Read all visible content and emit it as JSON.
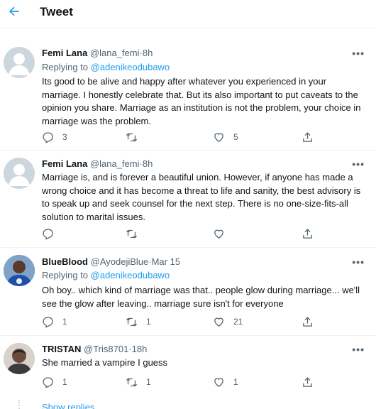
{
  "header": {
    "title": "Tweet"
  },
  "tweets": [
    {
      "name": "Femi Lana",
      "handle": "@lana_femi",
      "dot": "·",
      "time": "8h",
      "replying_prefix": "Replying to",
      "replying_to": "@adenikeodubawo",
      "text": "Its good to be alive and happy after whatever you experienced in your marriage. I honestly celebrate that. But its also important to put caveats to the opinion you share. Marriage as an institution is not the problem, your choice in marriage was the problem.",
      "counts": {
        "reply": "3",
        "retweet": "",
        "like": "5"
      }
    },
    {
      "name": "Femi Lana",
      "handle": "@lana_femi",
      "dot": "·",
      "time": "8h",
      "text": "Marriage is, and is forever a beautiful union. However, if anyone has made a wrong choice and it has become a threat to life and sanity, the best advisory is to speak up and seek counsel for the next step. There is no one-size-fits-all solution to marital issues.",
      "counts": {
        "reply": "",
        "retweet": "",
        "like": ""
      }
    },
    {
      "name": "BlueBlood",
      "handle": "@AyodejiBlue",
      "dot": "·",
      "time": "Mar 15",
      "replying_prefix": "Replying to",
      "replying_to": "@adenikeodubawo",
      "text": "Oh boy.. which kind of marriage was that.. people glow during marriage... we'll see the glow after leaving.. marriage sure isn't for everyone",
      "counts": {
        "reply": "1",
        "retweet": "1",
        "like": "21"
      }
    },
    {
      "name": "TRISTAN",
      "handle": "@Tris8701",
      "dot": "·",
      "time": "18h",
      "text": "She married a vampire I guess",
      "counts": {
        "reply": "1",
        "retweet": "1",
        "like": "1"
      }
    }
  ],
  "show_replies": "Show replies",
  "icons": {
    "back": "back-arrow-icon",
    "more": "more-icon",
    "reply": "reply-icon",
    "retweet": "retweet-icon",
    "like": "like-icon",
    "share": "share-icon"
  },
  "colors": {
    "accent": "#1d9bf0",
    "muted": "#536471",
    "text": "#0f1419"
  }
}
